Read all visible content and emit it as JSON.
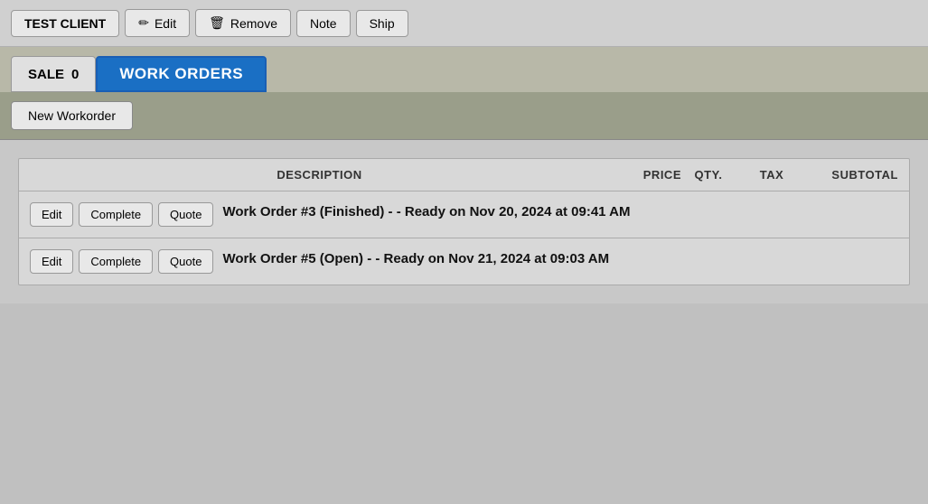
{
  "toolbar": {
    "client_label": "TEST CLIENT",
    "edit_label": "Edit",
    "remove_label": "Remove",
    "note_label": "Note",
    "ship_label": "Ship",
    "edit_icon": "✏",
    "remove_icon": "🗑"
  },
  "tabs": {
    "sale_label": "SALE",
    "sale_count": "0",
    "workorders_label": "WORK ORDERS"
  },
  "sub_actions": {
    "new_workorder_label": "New Workorder"
  },
  "table": {
    "columns": {
      "description": "DESCRIPTION",
      "price": "PRICE",
      "qty": "QTY.",
      "tax": "TAX",
      "subtotal": "SUBTOTAL"
    },
    "rows": [
      {
        "edit_label": "Edit",
        "complete_label": "Complete",
        "quote_label": "Quote",
        "description": "Work Order #3 (Finished) - - Ready on Nov 20, 2024 at 09:41 AM"
      },
      {
        "edit_label": "Edit",
        "complete_label": "Complete",
        "quote_label": "Quote",
        "description": "Work Order #5 (Open) - - Ready on Nov 21, 2024 at 09:03 AM"
      }
    ]
  }
}
